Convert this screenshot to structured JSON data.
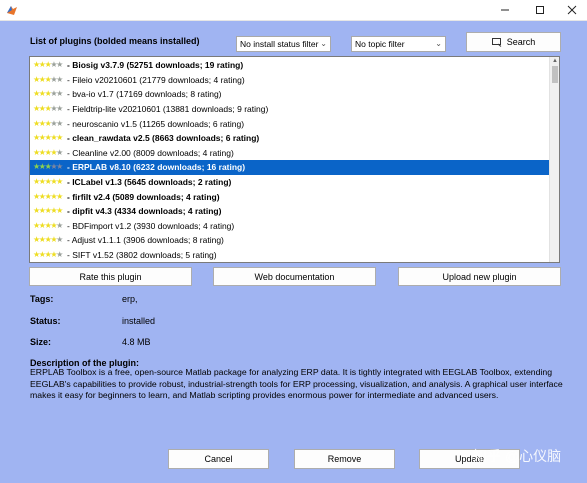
{
  "window": {
    "controls": [
      "minimize-icon",
      "maximize-icon",
      "close-icon"
    ]
  },
  "list": {
    "title": "List of plugins (bolded means installed)",
    "status_filter": "No install status filter",
    "topic_filter": "No topic filter",
    "search_label": "Search",
    "items": [
      {
        "text": "- Biosig v3.7.9 (52751 downloads; 19 rating)",
        "stars": 3,
        "installed": true,
        "selected": false
      },
      {
        "text": "- Fileio v20210601 (21779 downloads; 4 rating)",
        "stars": 3,
        "installed": false,
        "selected": false
      },
      {
        "text": "- bva-io v1.7 (17169 downloads; 8 rating)",
        "stars": 3,
        "installed": false,
        "selected": false
      },
      {
        "text": "- Fieldtrip-lite v20210601 (13881 downloads; 9 rating)",
        "stars": 3,
        "installed": false,
        "selected": false
      },
      {
        "text": "- neuroscanio v1.5 (11265 downloads; 6 rating)",
        "stars": 3,
        "installed": false,
        "selected": false
      },
      {
        "text": "- clean_rawdata v2.5 (8663 downloads; 6 rating)",
        "stars": 5,
        "installed": true,
        "selected": false
      },
      {
        "text": "- Cleanline v2.00 (8009 downloads; 4 rating)",
        "stars": 4,
        "installed": false,
        "selected": false
      },
      {
        "text": "- ERPLAB v8.10 (6232 downloads; 16 rating)",
        "stars": 3,
        "installed": true,
        "selected": true
      },
      {
        "text": "- ICLabel v1.3 (5645 downloads; 2 rating)",
        "stars": 5,
        "installed": true,
        "selected": false
      },
      {
        "text": "- firfilt v2.4 (5089 downloads; 4 rating)",
        "stars": 5,
        "installed": true,
        "selected": false
      },
      {
        "text": "- dipfit v4.3 (4334 downloads; 4 rating)",
        "stars": 5,
        "installed": true,
        "selected": false
      },
      {
        "text": "- BDFimport v1.2 (3930 downloads; 4 rating)",
        "stars": 4,
        "installed": false,
        "selected": false
      },
      {
        "text": "- Adjust v1.1.1 (3906 downloads; 8 rating)",
        "stars": 4,
        "installed": false,
        "selected": false
      },
      {
        "text": "- SIFT v1.52 (3802 downloads; 5 rating)",
        "stars": 4,
        "installed": false,
        "selected": false
      }
    ]
  },
  "actions": {
    "rate": "Rate this plugin",
    "web_doc": "Web documentation",
    "upload": "Upload new plugin"
  },
  "details": {
    "tags_label": "Tags:",
    "tags_value": "erp,",
    "status_label": "Status:",
    "status_value": "installed",
    "size_label": "Size:",
    "size_value": "4.8 MB",
    "description_label": "Description of the plugin:",
    "description": "ERPLAB Toolbox is a free, open-source Matlab package for analyzing ERP data. It is tightly integrated with EEGLAB Toolbox, extending EEGLAB's capabilities to provide robust, industrial-strength tools for ERP processing, visualization, and analysis. A graphical user interface makes it easy for beginners to learn, and Matlab scripting provides enormous power for intermediate and advanced users."
  },
  "footer": {
    "cancel": "Cancel",
    "remove": "Remove",
    "update": "Update"
  },
  "watermark": {
    "text": "知乎 @心仪脑"
  },
  "colors": {
    "background": "#a0b4f2",
    "selection": "#0a64c8",
    "star_on": "#eedd22",
    "star_off": "#9aa09a"
  }
}
